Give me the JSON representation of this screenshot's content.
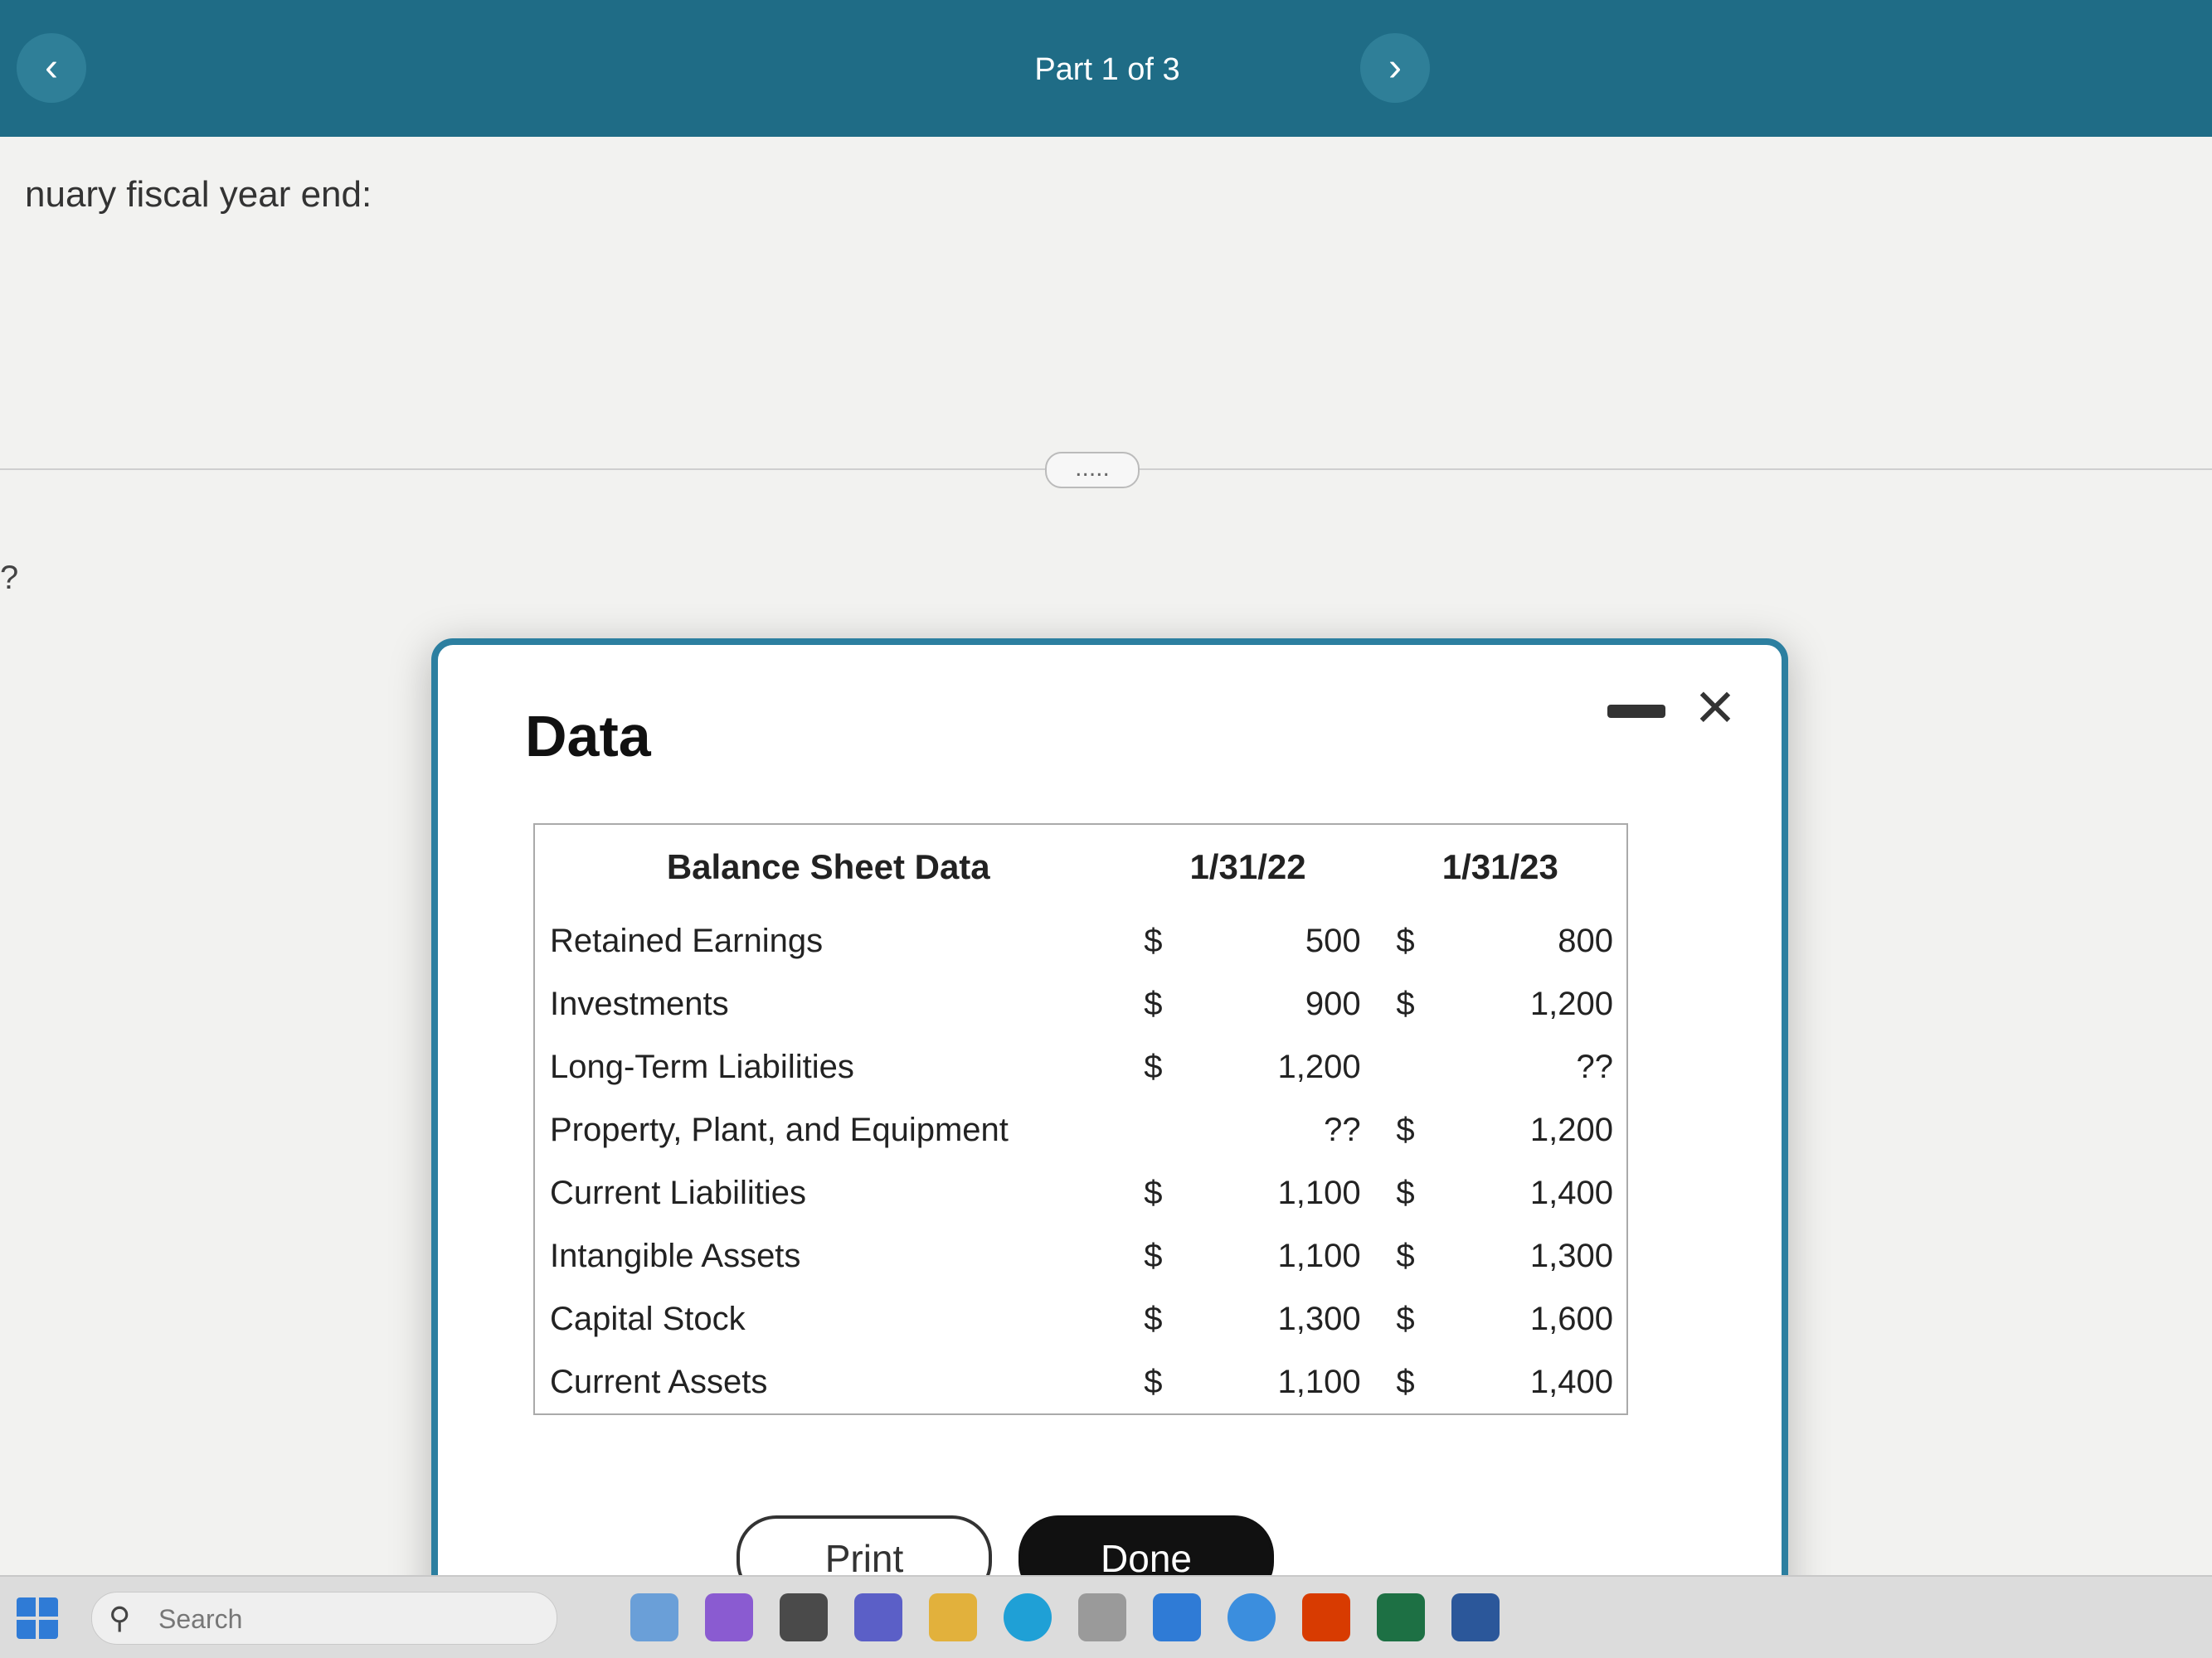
{
  "header": {
    "prev_icon": "‹",
    "next_icon": "›",
    "part_label": "Part 1 of 3"
  },
  "question": {
    "text": "nuary fiscal year end:",
    "side_mark": "?",
    "more_label": "....."
  },
  "dialog": {
    "title": "Data",
    "minimize_icon": "minimize",
    "close_icon": "×",
    "table": {
      "headers": [
        "Balance Sheet Data",
        "1/31/22",
        "1/31/23"
      ],
      "rows": [
        {
          "label": "Retained Earnings",
          "cur1": "$",
          "v1": "500",
          "cur2": "$",
          "v2": "800"
        },
        {
          "label": "Investments",
          "cur1": "$",
          "v1": "900",
          "cur2": "$",
          "v2": "1,200"
        },
        {
          "label": "Long-Term Liabilities",
          "cur1": "$",
          "v1": "1,200",
          "cur2": "",
          "v2": "??"
        },
        {
          "label": "Property, Plant, and Equipment",
          "cur1": "",
          "v1": "??",
          "cur2": "$",
          "v2": "1,200"
        },
        {
          "label": "Current Liabilities",
          "cur1": "$",
          "v1": "1,100",
          "cur2": "$",
          "v2": "1,400"
        },
        {
          "label": "Intangible Assets",
          "cur1": "$",
          "v1": "1,100",
          "cur2": "$",
          "v2": "1,300"
        },
        {
          "label": "Capital Stock",
          "cur1": "$",
          "v1": "1,300",
          "cur2": "$",
          "v2": "1,600"
        },
        {
          "label": "Current Assets",
          "cur1": "$",
          "v1": "1,100",
          "cur2": "$",
          "v2": "1,400"
        }
      ]
    },
    "print_label": "Print",
    "done_label": "Done"
  },
  "taskbar": {
    "search_placeholder": "Search",
    "search_icon": "⚲"
  },
  "colors": {
    "header": "#1f6c86",
    "dialog_border": "#2c7fa0",
    "done_button": "#111111"
  }
}
